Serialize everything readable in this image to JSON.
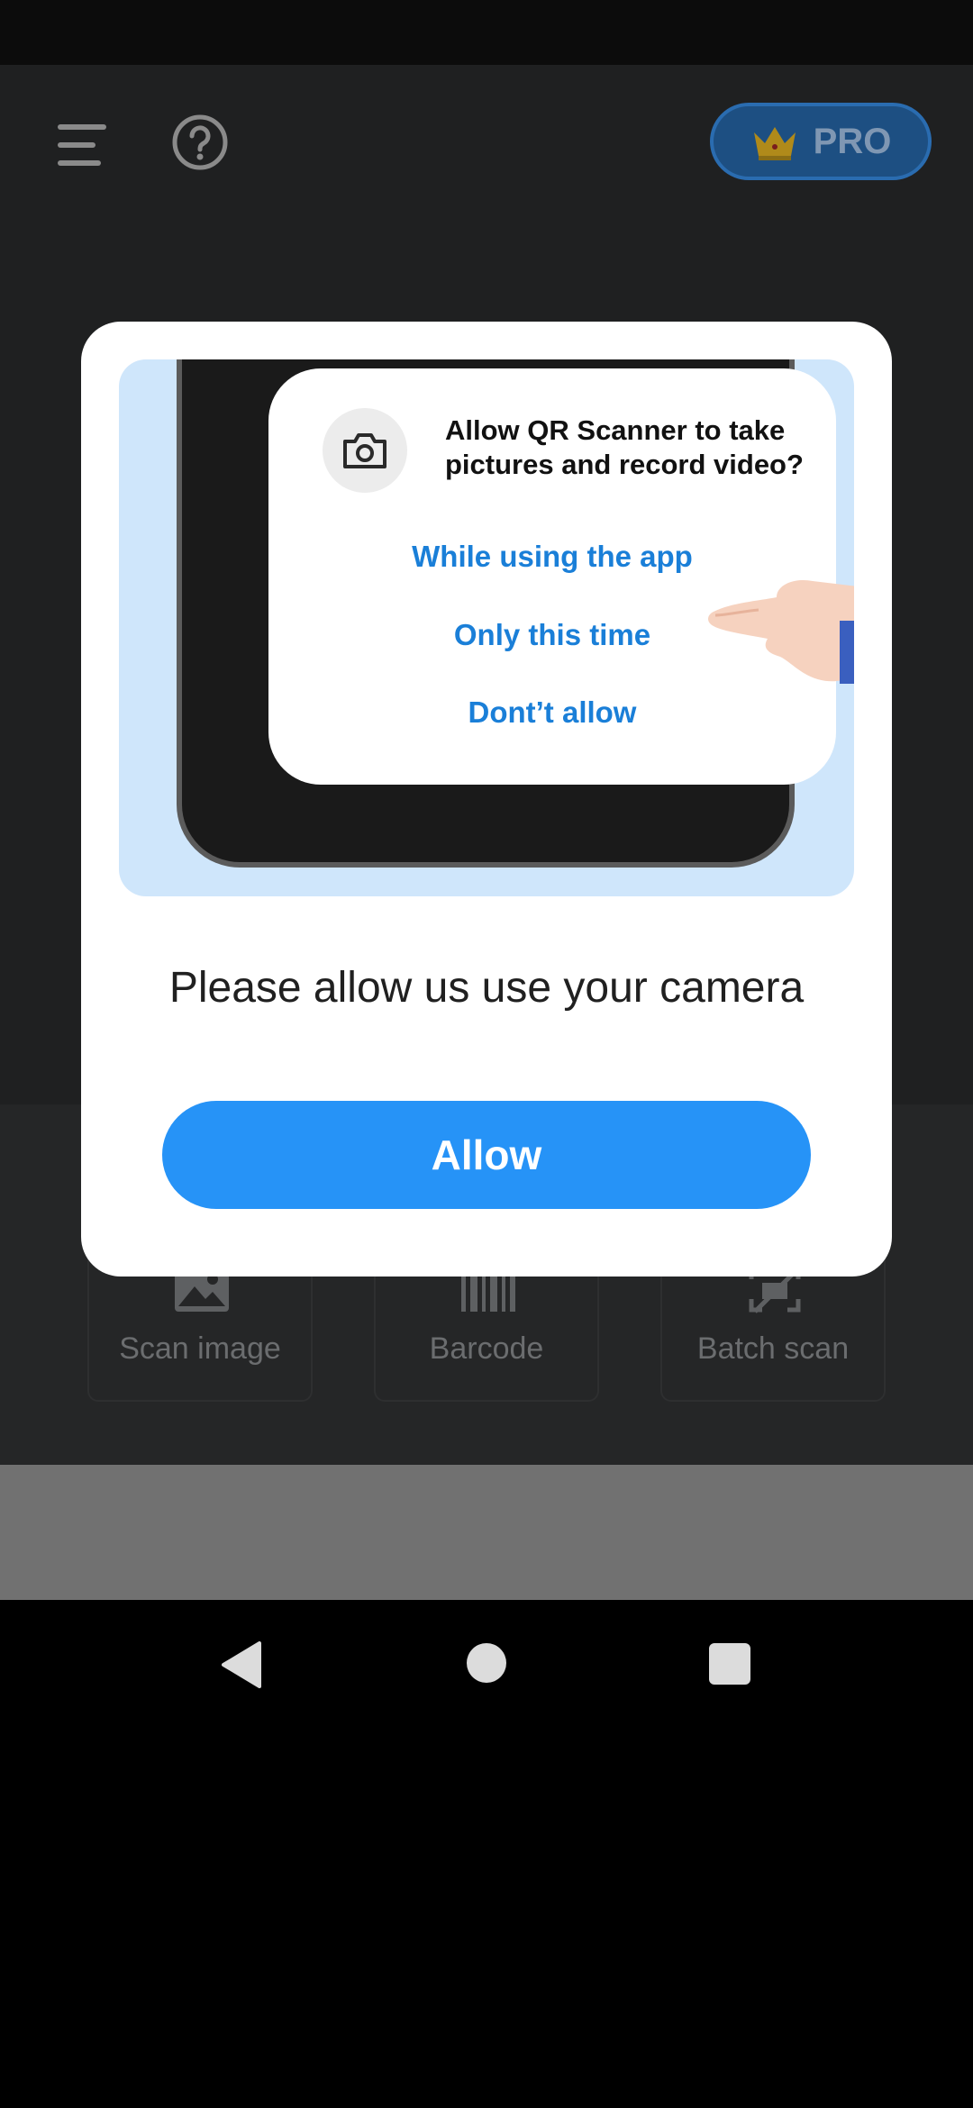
{
  "header": {
    "pro_label": "PRO"
  },
  "tools": [
    {
      "label": "Scan image"
    },
    {
      "label": "Barcode"
    },
    {
      "label": "Batch scan"
    }
  ],
  "dialog": {
    "illustration": {
      "question": "Allow QR Scanner to take pictures and record video?",
      "options": [
        "While using the app",
        "Only this time",
        "Dont’t allow"
      ]
    },
    "message": "Please allow us use your camera",
    "allow_label": "Allow"
  },
  "colors": {
    "accent": "#2693F7",
    "option_text": "#1A7FD8",
    "illustration_bg": "#CFE6FB"
  }
}
